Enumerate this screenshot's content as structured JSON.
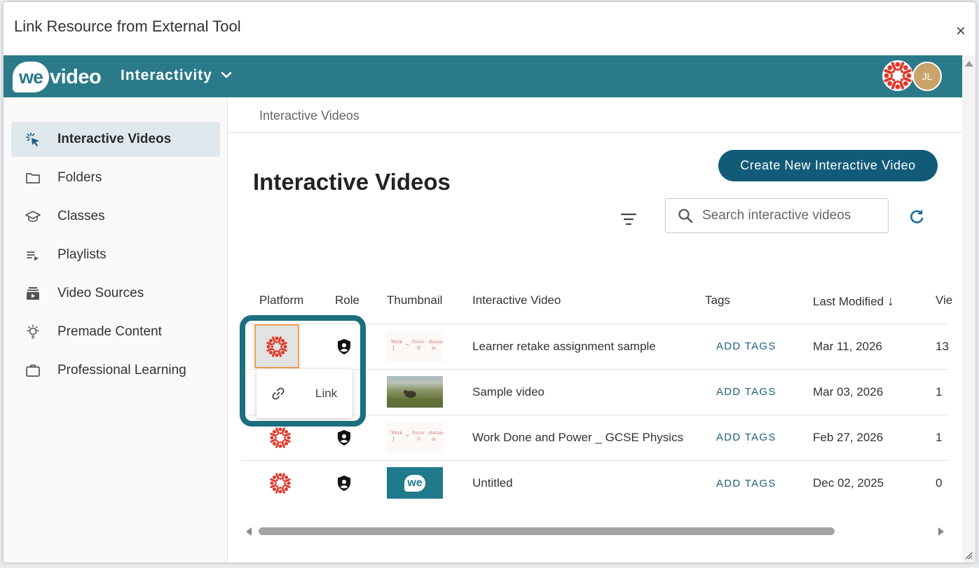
{
  "dialog": {
    "title": "Link Resource from External Tool",
    "close_label": "×"
  },
  "topbar": {
    "logo_we": "we",
    "logo_video": "video",
    "app_name": "Interactivity",
    "user_initials": "JL",
    "brand_color": "#2a7a8a"
  },
  "sidebar": {
    "items": [
      {
        "label": "Interactive Videos",
        "icon": "pointer-click-icon",
        "active": true
      },
      {
        "label": "Folders",
        "icon": "folder-icon",
        "active": false
      },
      {
        "label": "Classes",
        "icon": "graduation-cap-icon",
        "active": false
      },
      {
        "label": "Playlists",
        "icon": "playlist-icon",
        "active": false
      },
      {
        "label": "Video Sources",
        "icon": "video-library-icon",
        "active": false
      },
      {
        "label": "Premade Content",
        "icon": "lightbulb-icon",
        "active": false
      },
      {
        "label": "Professional Learning",
        "icon": "briefcase-icon",
        "active": false
      }
    ]
  },
  "main": {
    "breadcrumb": "Interactive Videos",
    "title": "Interactive Videos",
    "create_button": "Create New Interactive Video",
    "search_placeholder": "Search interactive videos"
  },
  "table": {
    "columns": [
      "Platform",
      "Role",
      "Thumbnail",
      "Interactive Video",
      "Tags",
      "Last Modified",
      "Vie"
    ],
    "sort_indicator": "↓",
    "add_tags_label": "ADD TAGS",
    "rows": [
      {
        "title": "Learner retake assignment sample",
        "thumbnail": "writing",
        "modified": "Mar 11, 2026",
        "views": "13"
      },
      {
        "title": "Sample video",
        "thumbnail": "savanna",
        "modified": "Mar 03, 2026",
        "views": "1"
      },
      {
        "title": "Work Done and Power _ GCSE Physics",
        "thumbnail": "writing",
        "modified": "Feb 27, 2026",
        "views": "1"
      },
      {
        "title": "Untitled",
        "thumbnail": "we-logo",
        "modified": "Dec 02, 2025",
        "views": "0"
      }
    ]
  },
  "popup": {
    "label": "Link"
  },
  "colors": {
    "accent": "#125b78",
    "canvas_red": "#e0392b",
    "highlight": "#1b6f7e"
  }
}
